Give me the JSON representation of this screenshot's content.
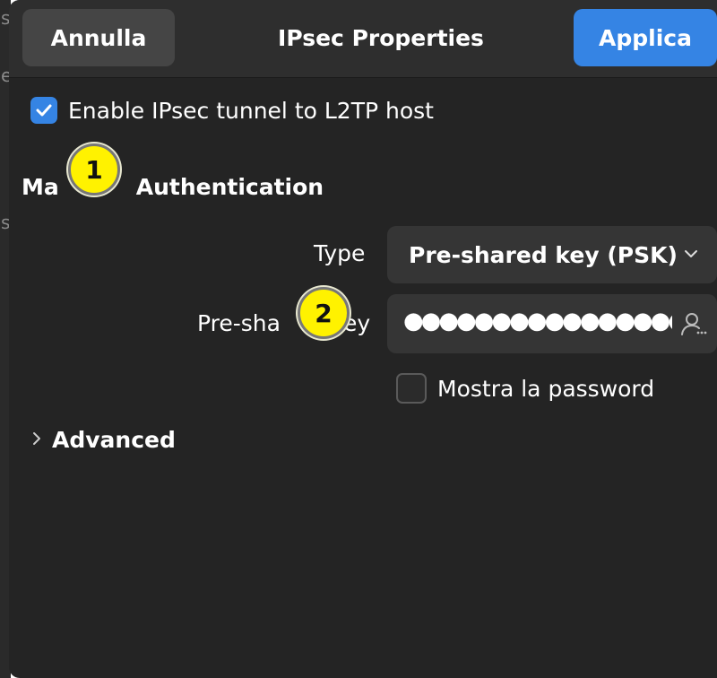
{
  "background": {
    "glyphs": [
      "s",
      "e",
      "s"
    ]
  },
  "header": {
    "cancel_label": "Annulla",
    "title": "IPsec Properties",
    "apply_label": "Applica"
  },
  "enable_ipsec": {
    "label": "Enable IPsec tunnel to L2TP host",
    "checked": true
  },
  "section": {
    "title_left": "Ma",
    "title_right": "Authentication"
  },
  "type_field": {
    "label": "Type",
    "value": "Pre-shared key (PSK)",
    "icon": "chevron-down-icon"
  },
  "psk_field": {
    "label_left": "Pre-sha",
    "label_right": "ey",
    "value": "●●●●●●●●●●●●●●●●",
    "icon": "user-password-icon"
  },
  "show_password": {
    "label": "Mostra la password",
    "checked": false
  },
  "advanced": {
    "label": "Advanced",
    "icon": "chevron-right-icon"
  },
  "markers": [
    {
      "label": "1"
    },
    {
      "label": "2"
    }
  ],
  "colors": {
    "accent": "#3584e4",
    "dialog_bg": "#242424",
    "header_bg": "#2e2e2e",
    "field_bg": "#353535",
    "marker_fill": "#fff200"
  }
}
